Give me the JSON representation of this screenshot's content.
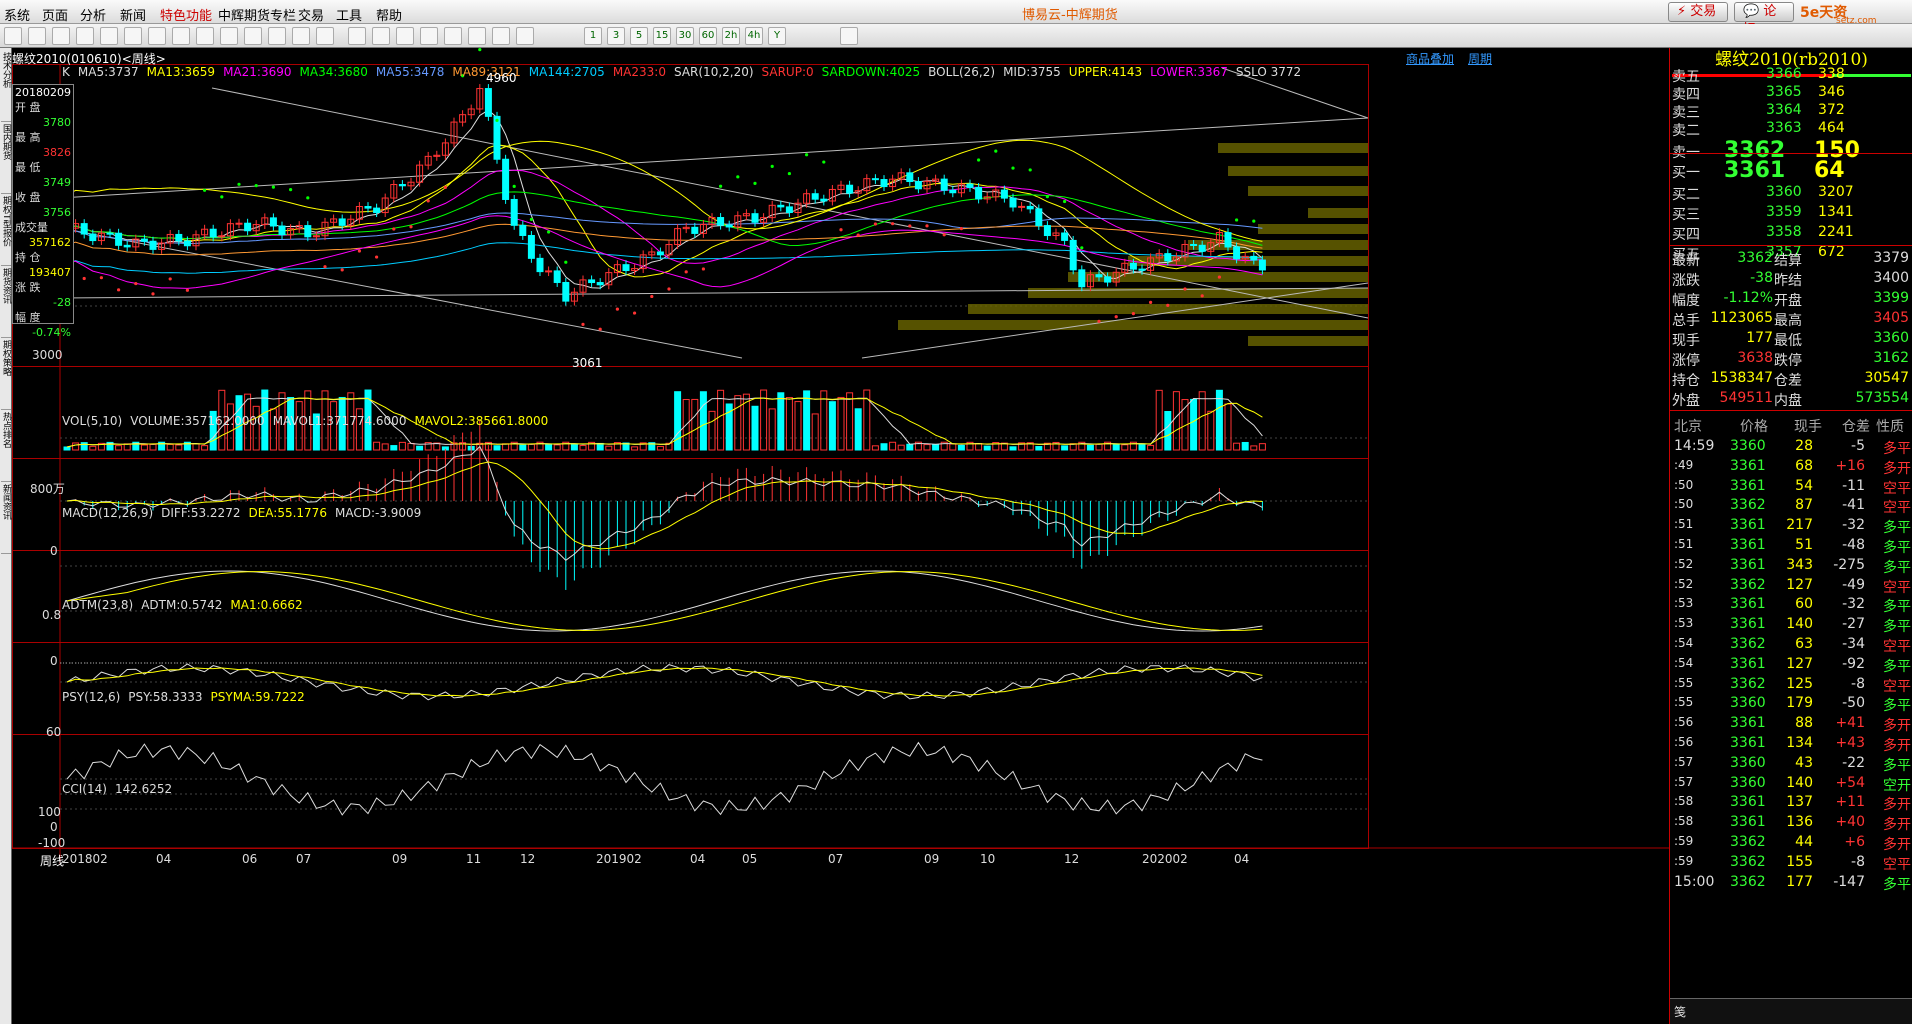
{
  "menu": [
    "系统",
    "页面",
    "分析",
    "新闻",
    "特色功能",
    "中辉期货专栏",
    "交易",
    "工具",
    "帮助"
  ],
  "app_title": "博易云-中辉期货",
  "btn_trade": "⚡ 交易",
  "btn_forum": "💬 论坛",
  "logo": "5e天资",
  "logo_sub": "setz.com",
  "toolbar_labels": [
    "1",
    "3",
    "5",
    "15",
    "30",
    "60",
    "2h",
    "4h",
    "Y"
  ],
  "chart_header": "螺纹2010(010610)<周线>",
  "link_add": "商品叠加",
  "link_period": "周期",
  "kline_legend": [
    {
      "t": "K",
      "c": "#ddd"
    },
    {
      "t": "MA5:3737",
      "c": "#ddd"
    },
    {
      "t": "MA13:3659",
      "c": "#ff0"
    },
    {
      "t": "MA21:3690",
      "c": "#f0f"
    },
    {
      "t": "MA34:3680",
      "c": "#0f0"
    },
    {
      "t": "MA55:3478",
      "c": "#69f"
    },
    {
      "t": "MA89:3121",
      "c": "#f93"
    },
    {
      "t": "MA144:2705",
      "c": "#0cf"
    },
    {
      "t": "MA233:0",
      "c": "#f33"
    },
    {
      "t": "SAR(10,2,20)",
      "c": "#ddd"
    },
    {
      "t": "SARUP:0",
      "c": "#f33"
    },
    {
      "t": "SARDOWN:4025",
      "c": "#0f0"
    },
    {
      "t": "BOLL(26,2)",
      "c": "#ddd"
    },
    {
      "t": "MID:3755",
      "c": "#ddd"
    },
    {
      "t": "UPPER:4143",
      "c": "#ff0"
    },
    {
      "t": "LOWER:3367",
      "c": "#f0f"
    },
    {
      "t": "SSLO 3772",
      "c": "#ddd"
    }
  ],
  "price_labels": {
    "top": "4960",
    "low": "3061",
    "axis_3000": "3000"
  },
  "info_box": [
    {
      "t": "20180209",
      "c": "#fff"
    },
    {
      "t": "开  盘",
      "c": "#ddd"
    },
    {
      "t": "3780",
      "c": "#3f3"
    },
    {
      "t": "最  高",
      "c": "#ddd"
    },
    {
      "t": "3826",
      "c": "#f33"
    },
    {
      "t": "最  低",
      "c": "#ddd"
    },
    {
      "t": "3749",
      "c": "#3f3"
    },
    {
      "t": "收  盘",
      "c": "#ddd"
    },
    {
      "t": "3756",
      "c": "#3f3"
    },
    {
      "t": "成交量",
      "c": "#ddd"
    },
    {
      "t": "357162",
      "c": "#ff0"
    },
    {
      "t": "持  仓",
      "c": "#ddd"
    },
    {
      "t": "193407",
      "c": "#ff0"
    },
    {
      "t": "涨  跌",
      "c": "#ddd"
    },
    {
      "t": "-28",
      "c": "#3f3"
    },
    {
      "t": "幅  度",
      "c": "#ddd"
    },
    {
      "t": "-0.74%",
      "c": "#3f3"
    }
  ],
  "vol_legend": [
    {
      "t": "VOL(5,10)",
      "c": "#ddd"
    },
    {
      "t": "VOLUME:357162.0000",
      "c": "#ddd"
    },
    {
      "t": "MAVOL1:371774.6000",
      "c": "#ddd"
    },
    {
      "t": "MAVOL2:385661.8000",
      "c": "#ff0"
    }
  ],
  "vol_axis": "800万",
  "macd_legend": [
    {
      "t": "MACD(12,26,9)",
      "c": "#ddd"
    },
    {
      "t": "DIFF:53.2272",
      "c": "#ddd"
    },
    {
      "t": "DEA:55.1776",
      "c": "#ff0"
    },
    {
      "t": "MACD:-3.9009",
      "c": "#ddd"
    }
  ],
  "macd_axis": "0",
  "adtm_legend": [
    {
      "t": "ADTM(23,8)",
      "c": "#ddd"
    },
    {
      "t": "ADTM:0.5742",
      "c": "#ddd"
    },
    {
      "t": "MA1:0.6662",
      "c": "#ff0"
    }
  ],
  "adtm_axis": [
    "0.8",
    "0"
  ],
  "psy_legend": [
    {
      "t": "PSY(12,6)",
      "c": "#ddd"
    },
    {
      "t": "PSY:58.3333",
      "c": "#ddd"
    },
    {
      "t": "PSYMA:59.7222",
      "c": "#ff0"
    }
  ],
  "psy_axis": "60",
  "cci_legend": [
    {
      "t": "CCI(14)",
      "c": "#ddd"
    },
    {
      "t": "142.6252",
      "c": "#ddd"
    }
  ],
  "cci_axis": [
    "100",
    "0",
    "-100"
  ],
  "period_label": "周线",
  "date_axis": [
    "201802",
    "04",
    "06",
    "07",
    "09",
    "11",
    "12",
    "201902",
    "04",
    "05",
    "07",
    "09",
    "10",
    "12",
    "202002",
    "04"
  ],
  "quote_title": "螺纹2010(rb2010)",
  "asks": [
    {
      "l": "卖五",
      "p": "3366",
      "v": "338"
    },
    {
      "l": "卖四",
      "p": "3365",
      "v": "346"
    },
    {
      "l": "卖三",
      "p": "3364",
      "v": "372"
    },
    {
      "l": "卖二",
      "p": "3363",
      "v": "464"
    },
    {
      "l": "卖一",
      "p": "3362",
      "v": "150"
    }
  ],
  "bids": [
    {
      "l": "买一",
      "p": "3361",
      "v": "64"
    },
    {
      "l": "买二",
      "p": "3360",
      "v": "3207"
    },
    {
      "l": "买三",
      "p": "3359",
      "v": "1341"
    },
    {
      "l": "买四",
      "p": "3358",
      "v": "2241"
    },
    {
      "l": "买五",
      "p": "3357",
      "v": "672"
    }
  ],
  "stats": [
    {
      "l1": "最新",
      "v1": "3362",
      "c1": "g",
      "l2": "结算",
      "v2": "3379",
      "c2": "w"
    },
    {
      "l1": "涨跌",
      "v1": "-38",
      "c1": "g",
      "l2": "昨结",
      "v2": "3400",
      "c2": "w"
    },
    {
      "l1": "幅度",
      "v1": "-1.12%",
      "c1": "g",
      "l2": "开盘",
      "v2": "3399",
      "c2": "g"
    },
    {
      "l1": "总手",
      "v1": "1123065",
      "c1": "y",
      "l2": "最高",
      "v2": "3405",
      "c2": "r"
    },
    {
      "l1": "现手",
      "v1": "177",
      "c1": "y",
      "l2": "最低",
      "v2": "3360",
      "c2": "g"
    },
    {
      "l1": "涨停",
      "v1": "3638",
      "c1": "r",
      "l2": "跌停",
      "v2": "3162",
      "c2": "g"
    },
    {
      "l1": "持仓",
      "v1": "1538347",
      "c1": "y",
      "l2": "仓差",
      "v2": "30547",
      "c2": "y"
    },
    {
      "l1": "外盘",
      "v1": "549511",
      "c1": "r",
      "l2": "内盘",
      "v2": "573554",
      "c2": "g"
    }
  ],
  "ticks_header": [
    "北京",
    "价格",
    "现手",
    "仓差",
    "性质"
  ],
  "ticks": [
    {
      "t": "14:59",
      "p": "3360",
      "q": "28",
      "d": "-5",
      "n": "多平",
      "nc": "r"
    },
    {
      "t": ":49",
      "p": "3361",
      "q": "68",
      "d": "+16",
      "n": "多开",
      "nc": "r"
    },
    {
      "t": ":50",
      "p": "3361",
      "q": "54",
      "d": "-11",
      "n": "空平",
      "nc": "r"
    },
    {
      "t": ":50",
      "p": "3362",
      "q": "87",
      "d": "-41",
      "n": "空平",
      "nc": "r"
    },
    {
      "t": ":51",
      "p": "3361",
      "q": "217",
      "d": "-32",
      "n": "多平",
      "nc": "g"
    },
    {
      "t": ":51",
      "p": "3361",
      "q": "51",
      "d": "-48",
      "n": "多平",
      "nc": "g"
    },
    {
      "t": ":52",
      "p": "3361",
      "q": "343",
      "d": "-275",
      "n": "多平",
      "nc": "g"
    },
    {
      "t": ":52",
      "p": "3362",
      "q": "127",
      "d": "-49",
      "n": "空平",
      "nc": "r"
    },
    {
      "t": ":53",
      "p": "3361",
      "q": "60",
      "d": "-32",
      "n": "多平",
      "nc": "g"
    },
    {
      "t": ":53",
      "p": "3361",
      "q": "140",
      "d": "-27",
      "n": "多平",
      "nc": "g"
    },
    {
      "t": ":54",
      "p": "3362",
      "q": "63",
      "d": "-34",
      "n": "空平",
      "nc": "r"
    },
    {
      "t": ":54",
      "p": "3361",
      "q": "127",
      "d": "-92",
      "n": "多平",
      "nc": "g"
    },
    {
      "t": ":55",
      "p": "3362",
      "q": "125",
      "d": "-8",
      "n": "空平",
      "nc": "r"
    },
    {
      "t": ":55",
      "p": "3360",
      "q": "179",
      "d": "-50",
      "n": "多平",
      "nc": "g"
    },
    {
      "t": ":56",
      "p": "3361",
      "q": "88",
      "d": "+41",
      "n": "多开",
      "nc": "r"
    },
    {
      "t": ":56",
      "p": "3361",
      "q": "134",
      "d": "+43",
      "n": "多开",
      "nc": "r"
    },
    {
      "t": ":57",
      "p": "3360",
      "q": "43",
      "d": "-22",
      "n": "多平",
      "nc": "g"
    },
    {
      "t": ":57",
      "p": "3360",
      "q": "140",
      "d": "+54",
      "n": "空开",
      "nc": "g"
    },
    {
      "t": ":58",
      "p": "3361",
      "q": "137",
      "d": "+11",
      "n": "多开",
      "nc": "r"
    },
    {
      "t": ":58",
      "p": "3361",
      "q": "136",
      "d": "+40",
      "n": "多开",
      "nc": "r"
    },
    {
      "t": ":59",
      "p": "3362",
      "q": "44",
      "d": "+6",
      "n": "多开",
      "nc": "r"
    },
    {
      "t": ":59",
      "p": "3362",
      "q": "155",
      "d": "-8",
      "n": "空平",
      "nc": "r"
    },
    {
      "t": "15:00",
      "p": "3362",
      "q": "177",
      "d": "-147",
      "n": "多平",
      "nc": "g"
    }
  ],
  "bottom_tab": "笺",
  "left_tabs": [
    "技术分析",
    "国内期货",
    "期权T型报价",
    "期货资讯",
    "期权策略",
    "热点排名",
    "新闻资讯"
  ]
}
